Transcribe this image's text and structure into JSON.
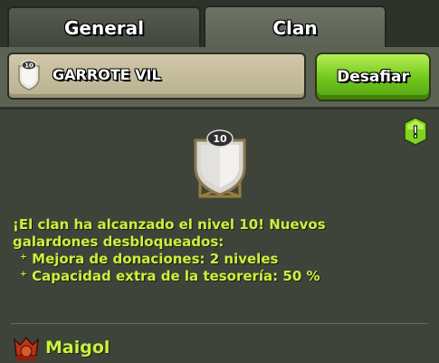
{
  "tabs": {
    "general": "General",
    "clan": "Clan"
  },
  "clan": {
    "badge_level": "10",
    "name": "GARROTE VIL",
    "challenge_label": "Desafiar"
  },
  "alert": {
    "symbol": "!"
  },
  "message": {
    "line1": "¡El clan ha alcanzado el nivel  10! Nuevos",
    "line2": "galardones desbloqueados:",
    "bullet1": "⁺ Mejora de donaciones: 2  niveles",
    "bullet2": "⁺ Capacidad extra de la tesorería: 50  %"
  },
  "member": {
    "name": "Maigol"
  },
  "colors": {
    "accent_green": "#c9f23b",
    "button_green": "#6fc51a",
    "panel_dark": "#3f443a"
  }
}
